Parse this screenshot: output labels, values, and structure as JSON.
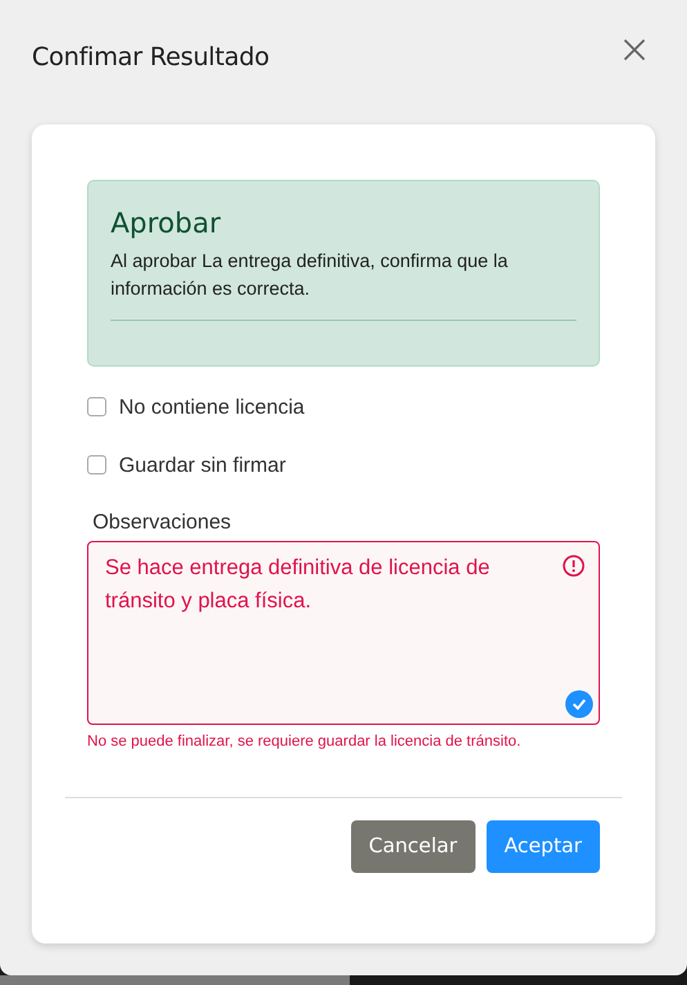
{
  "dialog": {
    "title": "Confimar Resultado"
  },
  "alert": {
    "heading": "Aprobar",
    "text": "Al aprobar La entrega definitiva, confirma que la información es correcta."
  },
  "options": [
    {
      "label": "No contiene licencia",
      "checked": false
    },
    {
      "label": "Guardar sin firmar",
      "checked": false
    }
  ],
  "observations": {
    "label": "Observaciones",
    "value": "Se hace entrega definitiva de licencia de tránsito y placa física.",
    "invalid": true,
    "error": "No se puede finalizar, se requiere guardar la licencia de tránsito."
  },
  "buttons": [
    {
      "label": "Cancelar",
      "kind": "secondary"
    },
    {
      "label": "Aceptar",
      "kind": "primary"
    }
  ]
}
